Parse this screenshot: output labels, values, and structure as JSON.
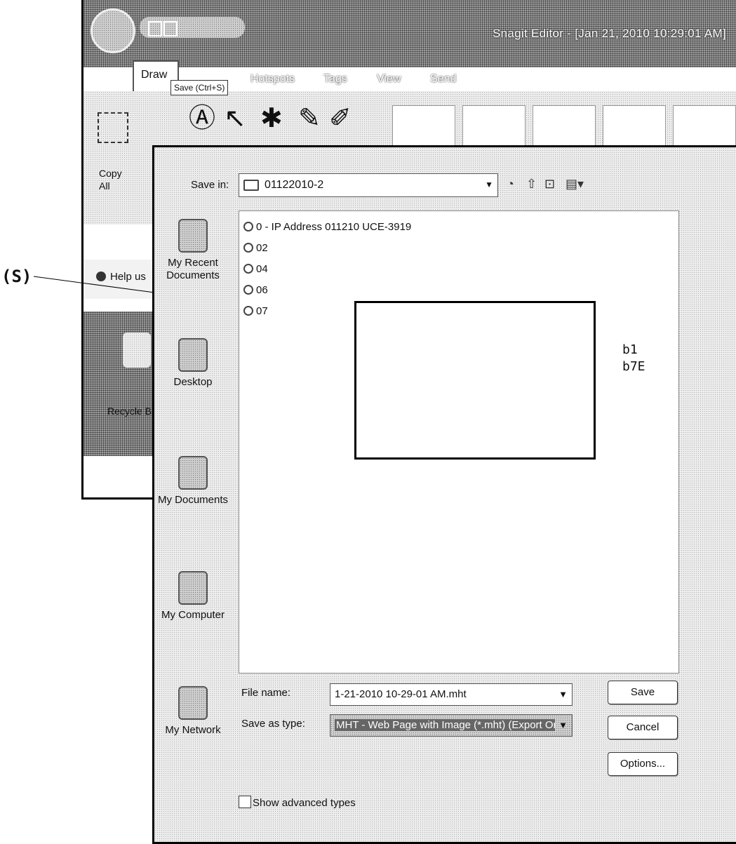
{
  "snagit": {
    "title": "Snagit Editor - [Jan 21, 2010 10:29:01 AM]",
    "tabs": [
      "Draw",
      "Hotspots",
      "Tags",
      "View",
      "Send"
    ],
    "tooltip": "Save (Ctrl+S)",
    "copy_all_label": "Copy All",
    "help_bar_text": "Help us",
    "recycle_bin_label": "Recycle Bin"
  },
  "callout": {
    "label": "(S)"
  },
  "dialog": {
    "save_in_label": "Save in:",
    "folder": "01122010-2",
    "places": [
      {
        "label": "My Recent Documents",
        "icon": "recent-documents-icon"
      },
      {
        "label": "Desktop",
        "icon": "desktop-icon"
      },
      {
        "label": "My Documents",
        "icon": "my-documents-icon"
      },
      {
        "label": "My Computer",
        "icon": "my-computer-icon"
      },
      {
        "label": "My Network",
        "icon": "my-network-icon"
      }
    ],
    "files": [
      "0 - IP Address 011210 UCE-3919",
      "02",
      "04",
      "06",
      "07"
    ],
    "redaction_codes": [
      "b1",
      "b7E"
    ],
    "file_name_label": "File name:",
    "file_name_value": "1-21-2010 10-29-01 AM.mht",
    "save_as_type_label": "Save as type:",
    "save_as_type_value": "MHT - Web Page with Image (*.mht) (Export Only)",
    "save_button": "Save",
    "cancel_button": "Cancel",
    "options_button": "Options...",
    "show_advanced_types": "Show advanced types"
  }
}
